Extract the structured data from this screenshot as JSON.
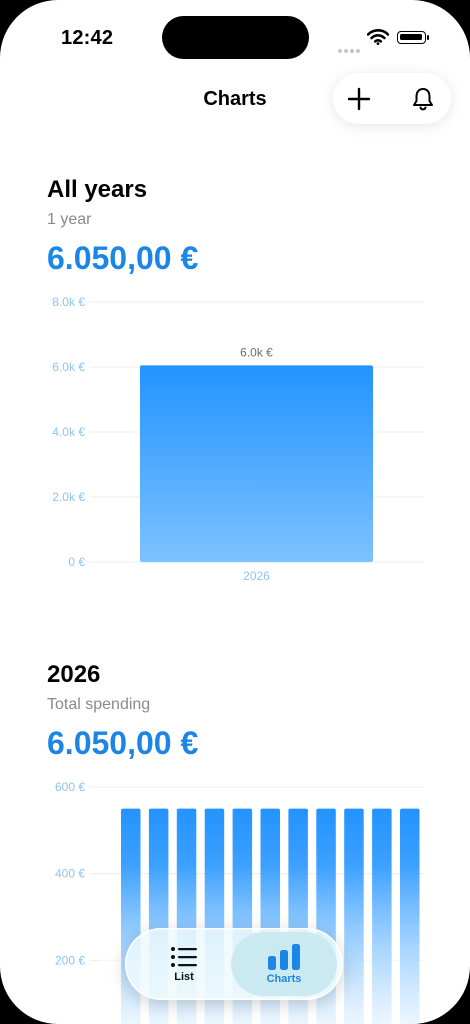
{
  "status_bar": {
    "time": "12:42"
  },
  "nav": {
    "title": "Charts",
    "add_icon": "plus-icon",
    "bell_icon": "bell-icon"
  },
  "sections": [
    {
      "title": "All years",
      "subtitle": "1 year",
      "total": "6.050,00 €",
      "chart_data": {
        "type": "bar",
        "categories": [
          "2026"
        ],
        "values": [
          6050
        ],
        "value_labels": [
          "6.0k €"
        ],
        "y_ticks": [
          {
            "value": 8000,
            "label": "8.0k €"
          },
          {
            "value": 6000,
            "label": "6.0k €"
          },
          {
            "value": 4000,
            "label": "4.0k €"
          },
          {
            "value": 2000,
            "label": "2.0k €"
          },
          {
            "value": 0,
            "label": "0 €"
          }
        ],
        "ylim": [
          0,
          8000
        ],
        "grid": true,
        "bar_color_top": "#2393ff",
        "bar_color_bottom": "#7cc2ff"
      }
    },
    {
      "title": "2026",
      "subtitle": "Total spending",
      "total": "6.050,00 €",
      "chart_data": {
        "type": "bar",
        "categories": [
          "",
          "",
          "",
          "",
          "",
          "",
          "",
          "",
          "",
          "",
          ""
        ],
        "values": [
          550,
          550,
          550,
          550,
          550,
          550,
          550,
          550,
          550,
          550,
          550
        ],
        "y_ticks": [
          {
            "value": 600,
            "label": "600 €"
          },
          {
            "value": 400,
            "label": "400 €"
          },
          {
            "value": 200,
            "label": "200 €"
          }
        ],
        "ylim": [
          0,
          600
        ],
        "grid": true,
        "bar_color_top": "#2393ff",
        "bar_color_bottom": "#8ecbff"
      }
    }
  ],
  "tabs": [
    {
      "label": "List",
      "icon": "list-icon",
      "selected": false
    },
    {
      "label": "Charts",
      "icon": "bar-chart-icon",
      "selected": true
    }
  ],
  "colors": {
    "accent": "#1b86e6",
    "axis_label": "#8fc4ef",
    "grid": "#ececec"
  }
}
